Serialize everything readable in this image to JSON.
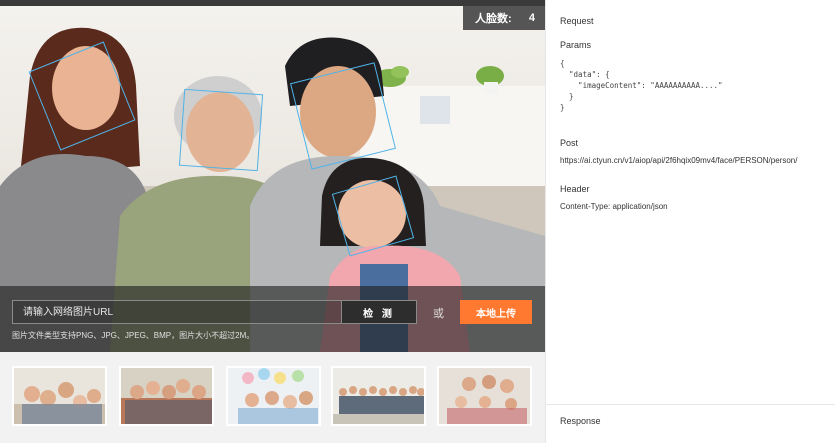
{
  "demo": {
    "face_count_label": "人脸数:",
    "face_count_value": "4",
    "url_placeholder": "请输入网络图片URL",
    "detect_label": "检 测",
    "or_label": "或",
    "upload_label": "本地上传",
    "hint": "图片文件类型支持PNG、JPG、JPEG、BMP，图片大小不超过2M。",
    "thumbnails": [
      "thumbnail-1",
      "thumbnail-2",
      "thumbnail-3",
      "thumbnail-4",
      "thumbnail-5"
    ]
  },
  "api": {
    "request_label": "Request",
    "params_label": "Params",
    "params_code": "{\n  \"data\": {\n    \"imageContent\": \"AAAAAAAAAA....\"\n  }\n}",
    "post_label": "Post",
    "post_url": "https://ai.ctyun.cn/v1/aiop/api/2f6hqix09mv4/face/PERSON/person/",
    "header_label": "Header",
    "header_value": "Content-Type: application/json",
    "response_label": "Response"
  },
  "colors": {
    "accent": "#ff7a30",
    "face_box": "#4fb3e8"
  }
}
